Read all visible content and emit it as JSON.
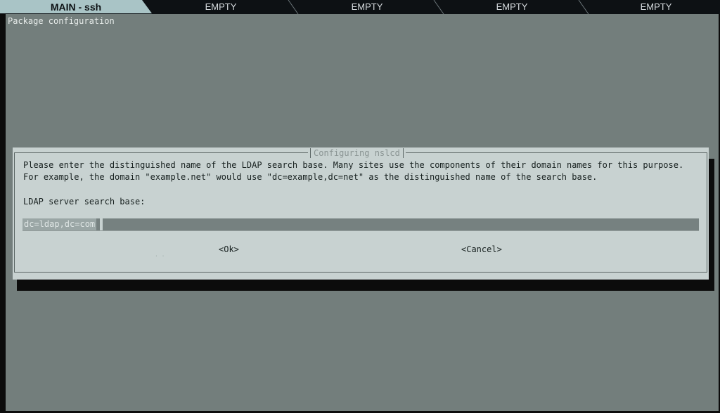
{
  "tabs": [
    {
      "label": "MAIN - ssh",
      "active": true
    },
    {
      "label": "EMPTY",
      "active": false
    },
    {
      "label": "EMPTY",
      "active": false
    },
    {
      "label": "EMPTY",
      "active": false
    },
    {
      "label": "EMPTY",
      "active": false
    }
  ],
  "terminal": {
    "screen_title": "Package configuration"
  },
  "dialog": {
    "title": "Configuring nslcd",
    "line1": "Please enter the distinguished name of the LDAP search base. Many sites use the components of their domain names for this purpose.",
    "line2": "For example, the domain \"example.net\" would use \"dc=example,dc=net\" as the distinguished name of the search base.",
    "prompt": "LDAP server search base:",
    "input_value": "dc=ldap,dc=com",
    "ok_label": "<Ok>",
    "cancel_label": "<Cancel>"
  },
  "colors": {
    "terminal_bg": "#737e7c",
    "dialog_bg": "#c8d2d1",
    "active_tab_bg": "#a9c4c6",
    "tabbar_bg": "#0d1114"
  }
}
